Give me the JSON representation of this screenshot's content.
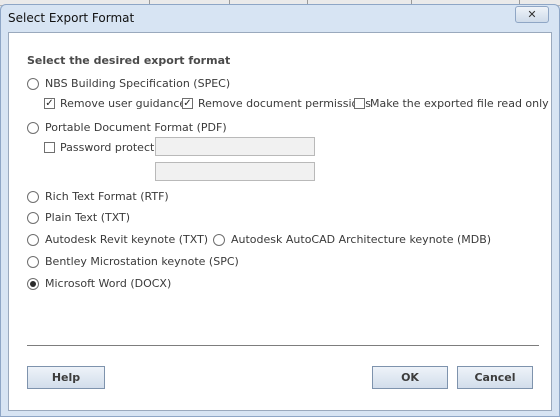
{
  "dialog": {
    "title": "Select Export Format",
    "close_label": "✕"
  },
  "form": {
    "heading": "Select the desired export format",
    "options": [
      {
        "label": "NBS Building Specification (SPEC)",
        "selected": false
      },
      {
        "label": "Portable Document Format (PDF)",
        "selected": false
      },
      {
        "label": "Rich Text Format (RTF)",
        "selected": false
      },
      {
        "label": "Plain Text (TXT)",
        "selected": false
      },
      {
        "label": "Autodesk Revit keynote (TXT)",
        "selected": false
      },
      {
        "label": "Autodesk AutoCAD Architecture keynote (MDB)",
        "selected": false
      },
      {
        "label": "Bentley Microstation keynote (SPC)",
        "selected": false
      },
      {
        "label": "Microsoft Word (DOCX)",
        "selected": true
      }
    ],
    "spec_options": {
      "remove_guidance": {
        "label": "Remove user guidance",
        "checked": true
      },
      "remove_permissions": {
        "label": "Remove document permissions",
        "checked": true
      },
      "read_only": {
        "label": "Make the exported file read only",
        "checked": false
      }
    },
    "pdf_options": {
      "password_protect": {
        "label": "Password protect:",
        "checked": false
      },
      "password_value": "",
      "confirm_value": ""
    }
  },
  "buttons": {
    "help": "Help",
    "ok": "OK",
    "cancel": "Cancel"
  },
  "colors": {
    "accent": "#d7e4f3",
    "button_border": "#7e93ad"
  }
}
